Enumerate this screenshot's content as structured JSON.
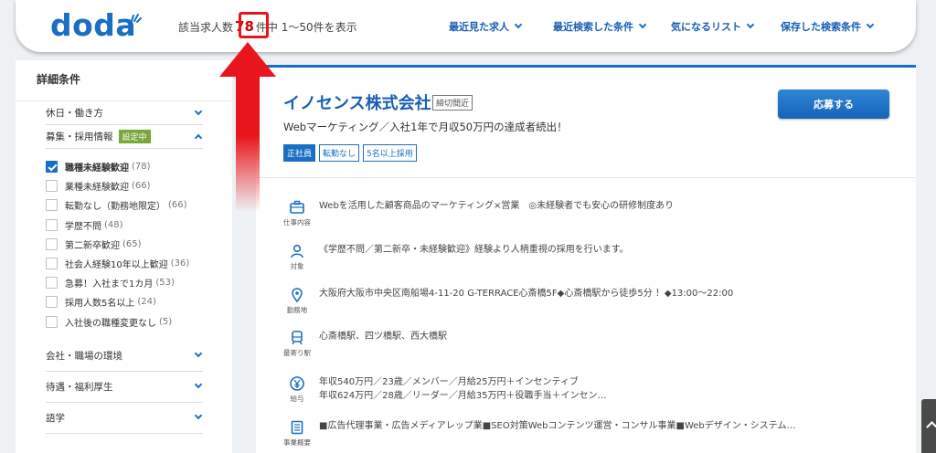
{
  "header": {
    "logo": "doda",
    "count_prefix": "該当求人数",
    "count": "78",
    "count_suffix": "件中 1〜50件を表示",
    "nav": [
      {
        "label": "最近見た求人"
      },
      {
        "label": "最近検索した条件"
      },
      {
        "label": "気になるリスト"
      },
      {
        "label": "保存した検索条件"
      }
    ]
  },
  "sidebar": {
    "title": "詳細条件",
    "sections_top": [
      {
        "label": "休日・働き方"
      }
    ],
    "active_section": {
      "label": "募集・採用情報",
      "badge": "設定中"
    },
    "checks": [
      {
        "label": "職種未経験歓迎",
        "count": "(78)",
        "checked": true
      },
      {
        "label": "業種未経験歓迎",
        "count": "(66)",
        "checked": false
      },
      {
        "label": "転勤なし（勤務地限定）",
        "count": "(66)",
        "checked": false
      },
      {
        "label": "学歴不問",
        "count": "(48)",
        "checked": false
      },
      {
        "label": "第二新卒歓迎",
        "count": "(65)",
        "checked": false
      },
      {
        "label": "社会人経験10年以上歓迎",
        "count": "(36)",
        "checked": false
      },
      {
        "label": "急募！入社まで1カ月",
        "count": "(53)",
        "checked": false
      },
      {
        "label": "採用人数5名以上",
        "count": "(24)",
        "checked": false
      },
      {
        "label": "入社後の職種変更なし",
        "count": "(5)",
        "checked": false
      }
    ],
    "sections_bottom": [
      {
        "label": "会社・職場の環境"
      },
      {
        "label": "待遇・福利厚生"
      },
      {
        "label": "語学"
      }
    ]
  },
  "job": {
    "company": "イノセンス株式会社",
    "deadline_badge": "締切間近",
    "catch": "Webマーケティング／入社1年で月収50万円の達成者続出！",
    "tags": [
      "正社員",
      "転勤なし",
      "5名以上採用"
    ],
    "apply_label": "応募する",
    "info": [
      {
        "icon": "briefcase-icon",
        "caption": "仕事内容",
        "lines": [
          "Webを活用した顧客商品のマーケティング×営業　◎未経験者でも安心の研修制度あり"
        ]
      },
      {
        "icon": "person-icon",
        "caption": "対象",
        "lines": [
          "《学歴不問／第二新卒・未経験歓迎》経験より人柄重視の採用を行います。"
        ]
      },
      {
        "icon": "map-pin-icon",
        "caption": "勤務地",
        "lines": [
          "大阪府大阪市中央区南船場4-11-20 G-TERRACE心斎橋5F◆心斎橋駅から徒歩5分 ！◆13:00〜22:00"
        ]
      },
      {
        "icon": "train-icon",
        "caption": "最寄り駅",
        "lines": [
          "心斎橋駅、四ツ橋駅、西大橋駅"
        ]
      },
      {
        "icon": "yen-icon",
        "caption": "給与",
        "lines": [
          "年収540万円／23歳／メンバー／月給25万円＋インセンティブ",
          "年収624万円／28歳／リーダー／月給35万円＋役職手当＋インセン…"
        ]
      },
      {
        "icon": "document-icon",
        "caption": "事業概要",
        "lines": [
          "■広告代理事業・広告メディアレップ業■SEO対策Webコンテンツ運営・コンサル事業■Webデザイン・システム…"
        ]
      }
    ]
  },
  "colors": {
    "brand": "#1a6fc5",
    "highlight": "#e8151c",
    "badge_green": "#7aa73a"
  }
}
